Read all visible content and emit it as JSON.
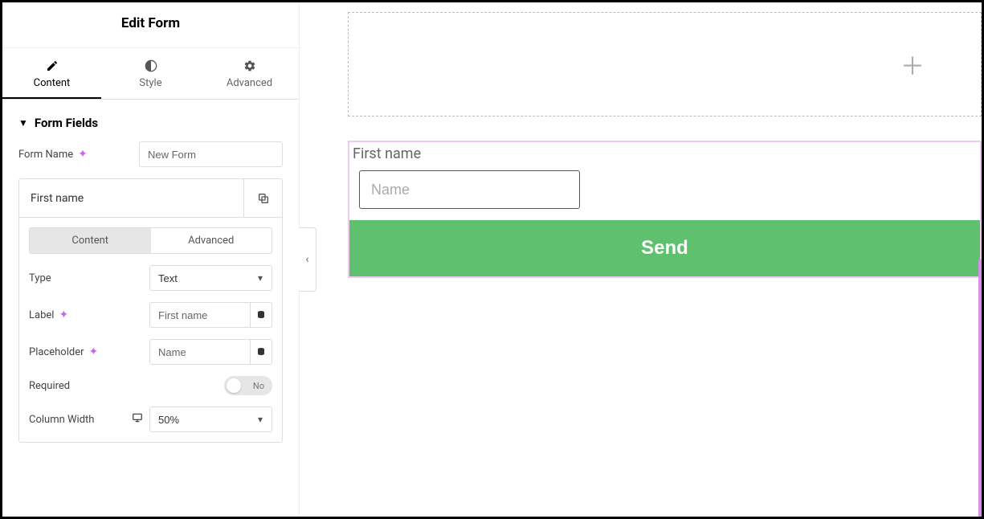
{
  "sidebar": {
    "title": "Edit Form",
    "tabs": {
      "content": "Content",
      "style": "Style",
      "advanced": "Advanced"
    },
    "section_title": "Form Fields",
    "form_name_label": "Form Name",
    "form_name_value": "New Form",
    "field": {
      "title": "First name",
      "tab_content": "Content",
      "tab_advanced": "Advanced",
      "type_label": "Type",
      "type_value": "Text",
      "label_label": "Label",
      "label_value": "First name",
      "placeholder_label": "Placeholder",
      "placeholder_value": "Name",
      "required_label": "Required",
      "required_value": "No",
      "column_width_label": "Column Width",
      "column_width_value": "50%"
    }
  },
  "canvas": {
    "form_label": "First name",
    "form_placeholder": "Name",
    "submit_label": "Send"
  }
}
